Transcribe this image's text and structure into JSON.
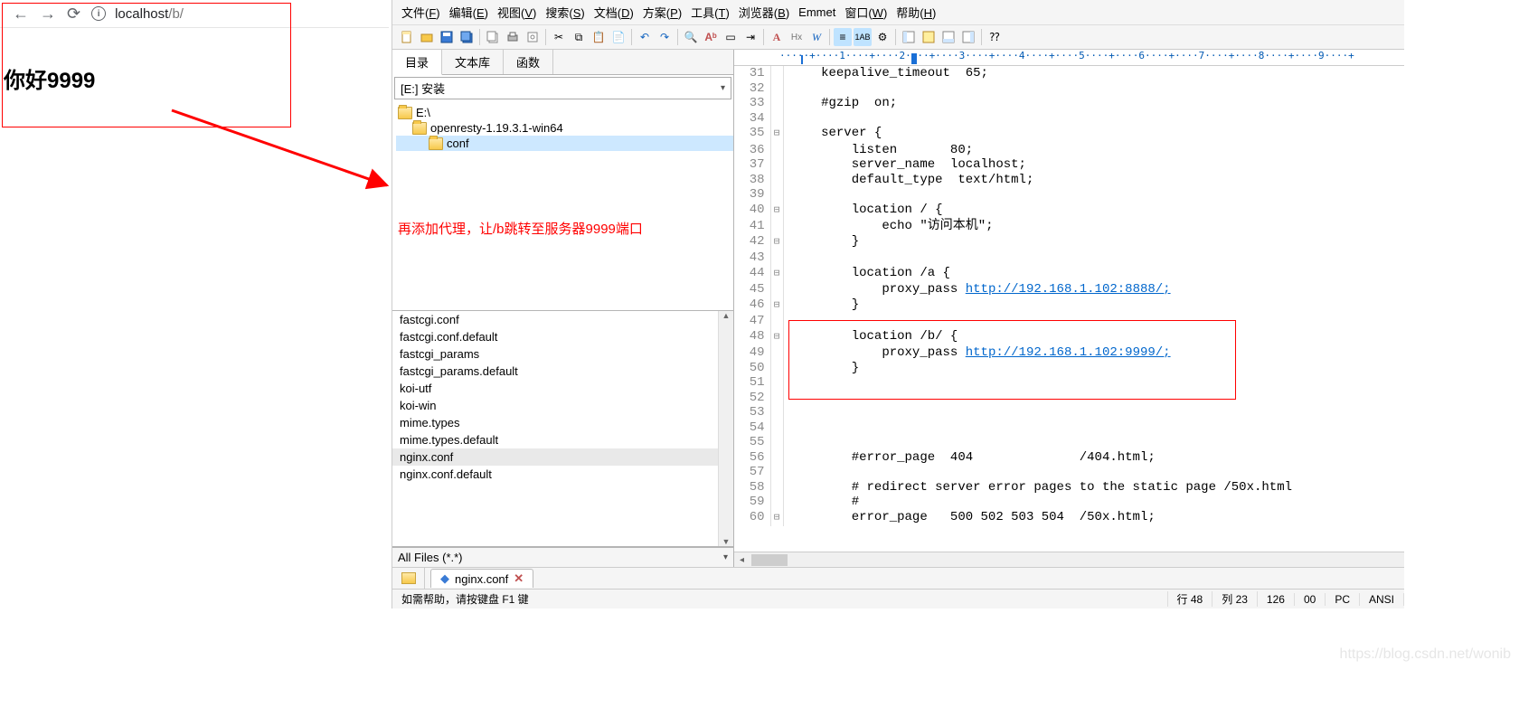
{
  "browser": {
    "url_host": "localhost",
    "url_path": "/b/",
    "page_heading": "你好9999"
  },
  "annotation": {
    "tree_note": "再添加代理，让/b跳转至服务器9999端口"
  },
  "menubar": [
    "文件(F)",
    "编辑(E)",
    "视图(V)",
    "搜索(S)",
    "文档(D)",
    "方案(P)",
    "工具(T)",
    "浏览器(B)",
    "Emmet",
    "窗口(W)",
    "帮助(H)"
  ],
  "side_tabs": [
    "目录",
    "文本库",
    "函数"
  ],
  "drive_label": "[E:] 安装",
  "tree": [
    {
      "indent": 0,
      "label": "E:\\"
    },
    {
      "indent": 1,
      "label": "openresty-1.19.3.1-win64"
    },
    {
      "indent": 2,
      "label": "conf",
      "selected": true
    }
  ],
  "files": [
    "fastcgi.conf",
    "fastcgi.conf.default",
    "fastcgi_params",
    "fastcgi_params.default",
    "koi-utf",
    "koi-win",
    "mime.types",
    "mime.types.default",
    "nginx.conf",
    "nginx.conf.default"
  ],
  "files_selected": "nginx.conf",
  "filter_label": "All Files (*.*)",
  "ruler_text": "·····+····1····+····2····+····3····+····4····+····5····+····6····+····7····+····8····+····9····+",
  "code": [
    {
      "n": 31,
      "f": "",
      "t": "    keepalive_timeout  65;"
    },
    {
      "n": 32,
      "f": "",
      "t": ""
    },
    {
      "n": 33,
      "f": "",
      "t": "    #gzip  on;"
    },
    {
      "n": 34,
      "f": "",
      "t": ""
    },
    {
      "n": 35,
      "f": "⊟",
      "t": "    server {"
    },
    {
      "n": 36,
      "f": "",
      "t": "        listen       80;"
    },
    {
      "n": 37,
      "f": "",
      "t": "        server_name  localhost;"
    },
    {
      "n": 38,
      "f": "",
      "t": "        default_type  text/html;"
    },
    {
      "n": 39,
      "f": "",
      "t": ""
    },
    {
      "n": 40,
      "f": "⊟",
      "t": "        location / {"
    },
    {
      "n": 41,
      "f": "",
      "t": "            echo \"访问本机\";"
    },
    {
      "n": 42,
      "f": "⊟",
      "t": "        }"
    },
    {
      "n": 43,
      "f": "",
      "t": ""
    },
    {
      "n": 44,
      "f": "⊟",
      "t": "        location /a {"
    },
    {
      "n": 45,
      "f": "",
      "t": "            proxy_pass ",
      "link": "http://192.168.1.102:8888/;",
      "after": ""
    },
    {
      "n": 46,
      "f": "⊟",
      "t": "        }"
    },
    {
      "n": 47,
      "f": "",
      "t": ""
    },
    {
      "n": 48,
      "f": "⊟",
      "t": "        location /b/ {"
    },
    {
      "n": 49,
      "f": "",
      "t": "            proxy_pass ",
      "link": "http://192.168.1.102:9999/;",
      "after": ""
    },
    {
      "n": 50,
      "f": "",
      "t": "        }"
    },
    {
      "n": 51,
      "f": "",
      "t": ""
    },
    {
      "n": 52,
      "f": "",
      "t": ""
    },
    {
      "n": 53,
      "f": "",
      "t": ""
    },
    {
      "n": 54,
      "f": "",
      "t": ""
    },
    {
      "n": 55,
      "f": "",
      "t": ""
    },
    {
      "n": 56,
      "f": "",
      "t": "        #error_page  404              /404.html;"
    },
    {
      "n": 57,
      "f": "",
      "t": ""
    },
    {
      "n": 58,
      "f": "",
      "t": "        # redirect server error pages to the static page /50x.html"
    },
    {
      "n": 59,
      "f": "",
      "t": "        #"
    },
    {
      "n": 60,
      "f": "⊟",
      "t": "        error_page   500 502 503 504  /50x.html;"
    }
  ],
  "doc_tab": {
    "label": "nginx.conf"
  },
  "status": {
    "help": "如需帮助，请按键盘 F1 键",
    "line": "行 48",
    "col": "列 23",
    "num": "126",
    "zero": "00",
    "mode": "PC",
    "enc": "ANSI"
  },
  "watermark": "https://blog.csdn.net/wonib"
}
